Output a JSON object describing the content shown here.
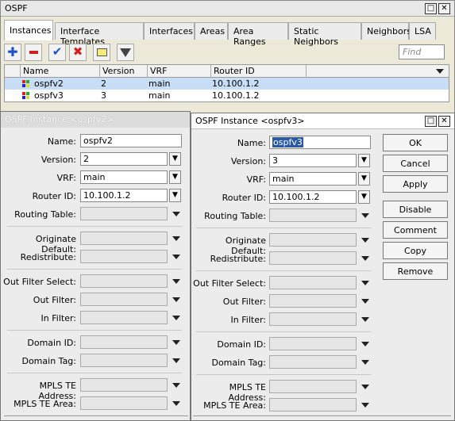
{
  "main": {
    "title": "OSPF",
    "tabs": [
      "Instances",
      "Interface Templates",
      "Interfaces",
      "Areas",
      "Area Ranges",
      "Static Neighbors",
      "Neighbors",
      "LSA"
    ],
    "find_placeholder": "Find",
    "columns": [
      "Name",
      "Version",
      "VRF",
      "Router ID"
    ],
    "rows": [
      {
        "name": "ospfv2",
        "version": "2",
        "vrf": "main",
        "router_id": "10.100.1.2"
      },
      {
        "name": "ospfv3",
        "version": "3",
        "vrf": "main",
        "router_id": "10.100.1.2"
      }
    ]
  },
  "labels": {
    "name": "Name:",
    "version": "Version:",
    "vrf": "VRF:",
    "router_id": "Router ID:",
    "routing_table": "Routing Table:",
    "originate_default": "Originate Default:",
    "redistribute": "Redistribute:",
    "out_filter_select": "Out Filter Select:",
    "out_filter": "Out Filter:",
    "in_filter": "In Filter:",
    "domain_id": "Domain ID:",
    "domain_tag": "Domain Tag:",
    "mpls_te_address": "MPLS TE Address:",
    "mpls_te_area": "MPLS TE Area:"
  },
  "v2": {
    "title": "OSPF Instance <ospfv2>",
    "name": "ospfv2",
    "version": "2",
    "vrf": "main",
    "router_id": "10.100.1.2"
  },
  "v3": {
    "title": "OSPF Instance <ospfv3>",
    "name": "ospfv3",
    "version": "3",
    "vrf": "main",
    "router_id": "10.100.1.2",
    "buttons": [
      "OK",
      "Cancel",
      "Apply",
      "Disable",
      "Comment",
      "Copy",
      "Remove"
    ]
  },
  "colors": {
    "selected_row": "#c8ddf6",
    "selection_highlight": "#2a5aa5"
  }
}
